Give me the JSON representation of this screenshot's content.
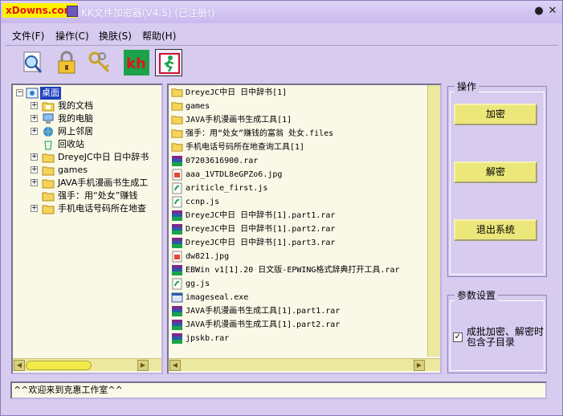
{
  "window": {
    "watermark": "xDowns.com",
    "title": "KK文件加密器(V4.5)  (已注册!)",
    "minimize_glyph": "●",
    "close_glyph": "✕"
  },
  "menu": {
    "items": [
      {
        "label": "文件(F)"
      },
      {
        "label": "操作(C)"
      },
      {
        "label": "换肤(S)"
      },
      {
        "label": "帮助(H)"
      }
    ]
  },
  "toolbar": {
    "tools": [
      {
        "icon": "magnifier-icon"
      },
      {
        "icon": "padlock-icon"
      },
      {
        "icon": "keys-icon"
      },
      {
        "icon": "kh-logo-icon",
        "text": "kh"
      },
      {
        "icon": "exit-runner-icon"
      }
    ]
  },
  "tree": {
    "root": "桌面",
    "items": [
      {
        "label": "我的文档",
        "icon": "folder-documents-icon"
      },
      {
        "label": "我的电脑",
        "icon": "computer-icon"
      },
      {
        "label": "网上邻居",
        "icon": "network-icon"
      },
      {
        "label": "回收站",
        "icon": "recycle-bin-icon"
      },
      {
        "label": "DreyeJC中日 日中辞书",
        "icon": "folder-icon"
      },
      {
        "label": "games",
        "icon": "folder-icon"
      },
      {
        "label": "JAVA手机漫画书生成工",
        "icon": "folder-icon"
      },
      {
        "label": "强手：用“处女”赚钱",
        "icon": "folder-icon"
      },
      {
        "label": "手机电话号码所在地查",
        "icon": "folder-icon"
      }
    ]
  },
  "files": {
    "items": [
      {
        "name": "DreyeJC中日 日中辞书[1]",
        "type": "folder"
      },
      {
        "name": "games",
        "type": "folder"
      },
      {
        "name": "JAVA手机漫画书生成工具[1]",
        "type": "folder"
      },
      {
        "name": "强手：用“处女”赚钱的富翁 处女.files",
        "type": "folder"
      },
      {
        "name": "手机电话号码所在地查询工具[1]",
        "type": "folder"
      },
      {
        "name": "07203616900.rar",
        "type": "rar"
      },
      {
        "name": "aaa_1VTDL8eGPZo6.jpg",
        "type": "jpg"
      },
      {
        "name": "ariticle_first.js",
        "type": "js"
      },
      {
        "name": "ccnp.js",
        "type": "js"
      },
      {
        "name": "DreyeJC中日 日中辞书[1].part1.rar",
        "type": "rar"
      },
      {
        "name": "DreyeJC中日 日中辞书[1].part2.rar",
        "type": "rar"
      },
      {
        "name": "DreyeJC中日 日中辞书[1].part3.rar",
        "type": "rar"
      },
      {
        "name": "dw821.jpg",
        "type": "jpg"
      },
      {
        "name": "EBWin v1[1].20 日文版-EPWING格式辞典打开工具.rar",
        "type": "rar"
      },
      {
        "name": "gg.js",
        "type": "js"
      },
      {
        "name": "imageseal.exe",
        "type": "exe"
      },
      {
        "name": "JAVA手机漫画书生成工具[1].part1.rar",
        "type": "rar"
      },
      {
        "name": "JAVA手机漫画书生成工具[1].part2.rar",
        "type": "rar"
      },
      {
        "name": "jpskb.rar",
        "type": "rar"
      }
    ]
  },
  "operations": {
    "title": "操作",
    "encrypt": "加密",
    "decrypt": "解密",
    "exit": "退出系统"
  },
  "params": {
    "title": "参数设置",
    "include_subdirs_label": "成批加密、解密时包含子目录",
    "include_subdirs_checked": true,
    "check_glyph": "✓"
  },
  "status": {
    "text": "^^欢迎来到克惠工作室^^"
  },
  "colors": {
    "window_bg": "#d7cbf0",
    "panel_bg": "#faf9e8",
    "button_bg": "#ece77a",
    "selection": "#1f3fbf",
    "watermark_bg": "#fff200",
    "watermark_fg": "#e3131b"
  }
}
